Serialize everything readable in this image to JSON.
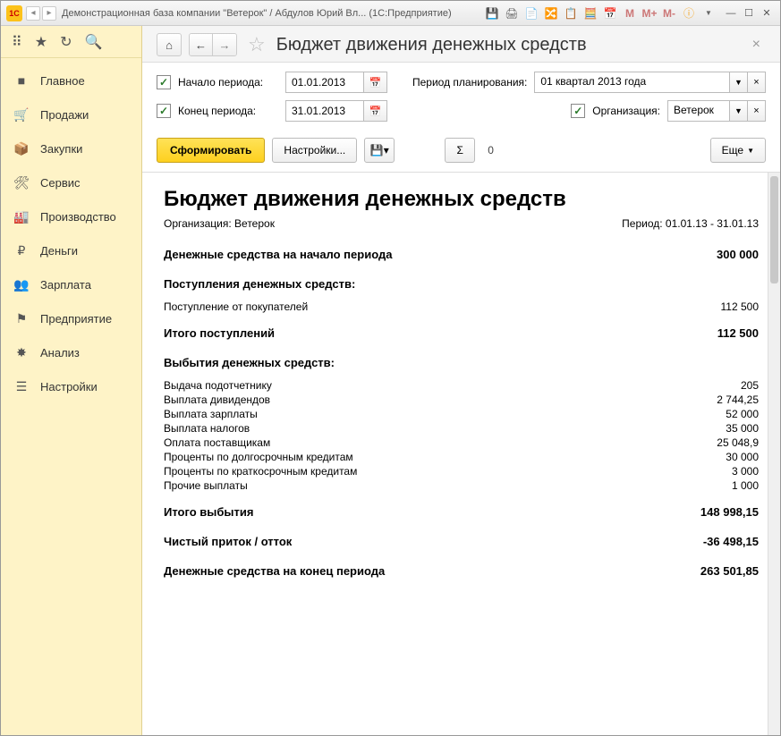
{
  "window": {
    "title": "Демонстрационная база компании \"Ветерок\" / Абдулов Юрий Вл...   (1С:Предприятие)",
    "memory_indicators": [
      "M",
      "M+",
      "M-"
    ]
  },
  "sidebar": {
    "items": [
      {
        "icon": "home",
        "label": "Главное"
      },
      {
        "icon": "cart",
        "label": "Продажи"
      },
      {
        "icon": "box",
        "label": "Закупки"
      },
      {
        "icon": "tools",
        "label": "Сервис"
      },
      {
        "icon": "factory",
        "label": "Производство"
      },
      {
        "icon": "ruble",
        "label": "Деньги"
      },
      {
        "icon": "people",
        "label": "Зарплата"
      },
      {
        "icon": "flag",
        "label": "Предприятие"
      },
      {
        "icon": "star",
        "label": "Анализ"
      },
      {
        "icon": "list",
        "label": "Настройки"
      }
    ]
  },
  "page": {
    "title": "Бюджет движения денежных средств"
  },
  "params": {
    "start_label": "Начало периода:",
    "start_value": "01.01.2013",
    "end_label": "Конец периода:",
    "end_value": "31.01.2013",
    "plan_label": "Период планирования:",
    "plan_value": "01 квартал 2013 года",
    "org_label": "Организация:",
    "org_value": "Ветерок"
  },
  "toolbar": {
    "generate": "Сформировать",
    "settings": "Настройки...",
    "sigma_value": "0",
    "more": "Еще"
  },
  "report": {
    "title": "Бюджет движения денежных средств",
    "org_meta": "Организация: Ветерок",
    "period_meta": "Период: 01.01.13 - 31.01.13",
    "opening_label": "Денежные средства на начало периода",
    "opening_value": "300 000",
    "inflows_header": "Поступления денежных средств:",
    "inflows": [
      {
        "label": "Поступление от покупателей",
        "value": "112 500"
      }
    ],
    "inflows_total_label": "Итого поступлений",
    "inflows_total_value": "112 500",
    "outflows_header": "Выбытия денежных средств:",
    "outflows": [
      {
        "label": "Выдача подотчетнику",
        "value": "205"
      },
      {
        "label": "Выплата дивидендов",
        "value": "2 744,25"
      },
      {
        "label": "Выплата зарплаты",
        "value": "52 000"
      },
      {
        "label": "Выплата налогов",
        "value": "35 000"
      },
      {
        "label": "Оплата поставщикам",
        "value": "25 048,9"
      },
      {
        "label": "Проценты по долгосрочным кредитам",
        "value": "30 000"
      },
      {
        "label": "Проценты по краткосрочным кредитам",
        "value": "3 000"
      },
      {
        "label": "Прочие выплаты",
        "value": "1 000"
      }
    ],
    "outflows_total_label": "Итого выбытия",
    "outflows_total_value": "148 998,15",
    "net_label": "Чистый приток / отток",
    "net_value": "-36 498,15",
    "closing_label": "Денежные средства на конец периода",
    "closing_value": "263 501,85"
  }
}
